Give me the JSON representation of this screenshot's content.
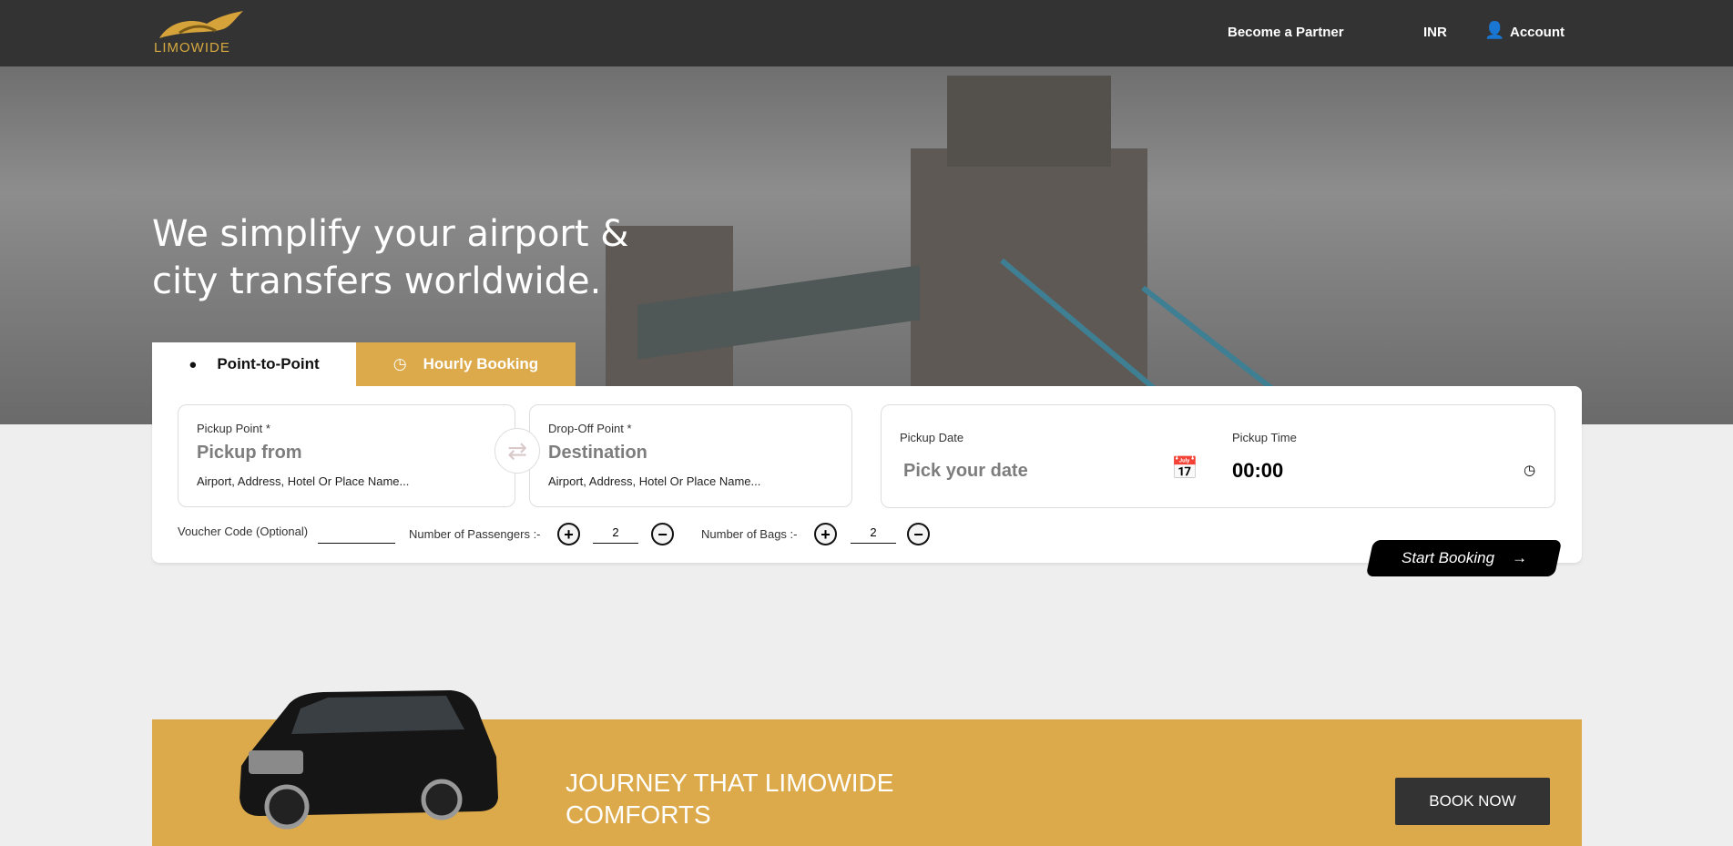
{
  "header": {
    "logo_text": "LIMOWIDE",
    "become_partner": "Become a Partner",
    "currency": "INR",
    "account": "Account"
  },
  "hero": {
    "headline_line1": "We simplify your airport &",
    "headline_line2": "city transfers worldwide."
  },
  "tabs": [
    {
      "label": "Point-to-Point",
      "icon": "map-pin-icon",
      "active": true
    },
    {
      "label": "Hourly Booking",
      "icon": "clock-icon",
      "active": false
    }
  ],
  "form": {
    "pickup": {
      "label": "Pickup Point *",
      "placeholder": "Pickup from",
      "hint": "Airport, Address, Hotel Or Place Name..."
    },
    "dropoff": {
      "label": "Drop-Off Point *",
      "placeholder": "Destination",
      "hint": "Airport, Address, Hotel Or Place Name..."
    },
    "date": {
      "label": "Pickup Date",
      "placeholder": "Pick your date"
    },
    "time": {
      "label": "Pickup Time",
      "value": "00:00"
    },
    "voucher_label": "Voucher Code (Optional)",
    "passengers_label": "Number of Passengers :-",
    "passengers": "2",
    "bags_label": "Number of Bags :-",
    "bags": "2",
    "start_booking": "Start Booking"
  },
  "banner": {
    "line1": "JOURNEY THAT LIMOWIDE",
    "line2": "COMFORTS",
    "button": "BOOK NOW"
  },
  "colors": {
    "accent": "#dcaa4a",
    "header": "#333333"
  }
}
